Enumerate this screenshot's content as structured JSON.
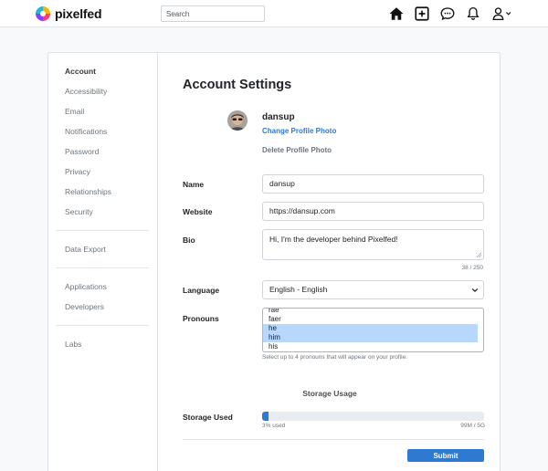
{
  "brand": {
    "name": "pixelfed"
  },
  "navbar": {
    "search_placeholder": "Search",
    "icons": [
      "home-icon",
      "plus-square-icon",
      "chat-icon",
      "bell-icon",
      "user-icon"
    ]
  },
  "sidebar": {
    "items": [
      {
        "label": "Account",
        "active": true
      },
      {
        "label": "Accessibility"
      },
      {
        "label": "Email"
      },
      {
        "label": "Notifications"
      },
      {
        "label": "Password"
      },
      {
        "label": "Privacy"
      },
      {
        "label": "Relationships"
      },
      {
        "label": "Security"
      },
      {
        "label": "Data Export"
      },
      {
        "label": "Applications"
      },
      {
        "label": "Developers"
      },
      {
        "label": "Labs"
      }
    ]
  },
  "account": {
    "title": "Account Settings",
    "username": "dansup",
    "change_photo": "Change Profile Photo",
    "delete_photo": "Delete Profile Photo",
    "fields": {
      "name_label": "Name",
      "name_value": "dansup",
      "website_label": "Website",
      "website_value": "https://dansup.com",
      "bio_label": "Bio",
      "bio_value": "Hi, I'm the developer behind Pixelfed!",
      "bio_counter": "38 / 250",
      "language_label": "Language",
      "language_value": "English - English",
      "pronouns_label": "Pronouns",
      "pronouns_options": [
        {
          "label": "rae",
          "selected": false
        },
        {
          "label": "faer",
          "selected": false
        },
        {
          "label": "he",
          "selected": true
        },
        {
          "label": "him",
          "selected": true
        },
        {
          "label": "his",
          "selected": false
        }
      ],
      "pronouns_help": "Select up to 4 pronouns that will appear on your profile."
    },
    "storage": {
      "section_title": "Storage Usage",
      "label": "Storage Used",
      "percent": 3,
      "percent_text": "3% used",
      "limit_text": "99M / 5G"
    },
    "submit_label": "Submit"
  },
  "colors": {
    "accent": "#2e7ad1",
    "selected_option": "#b8d7fd"
  }
}
